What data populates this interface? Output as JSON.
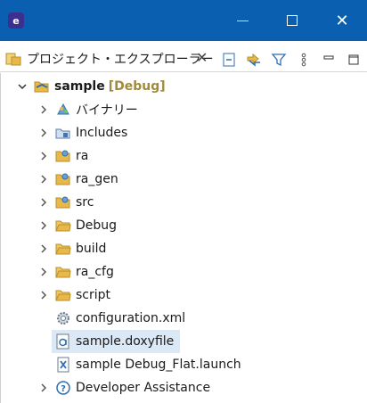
{
  "window": {
    "app_icon_glyph": "e",
    "minimize_glyph": "—",
    "close_glyph": "✕"
  },
  "view": {
    "tab_title": "プロジェクト・エクスプローラー",
    "tab_close_glyph": "✕",
    "toolbar_icons": [
      "collapse-all-icon",
      "link-with-editor-icon",
      "filter-icon",
      "view-menu-icon",
      "minimize-icon",
      "maximize-icon"
    ]
  },
  "tree": {
    "project": {
      "name": "sample",
      "decoration": "[Debug]"
    },
    "items": [
      {
        "label": "バイナリー",
        "icon": "binaries-icon"
      },
      {
        "label": "Includes",
        "icon": "includes-icon"
      },
      {
        "label": "ra",
        "icon": "source-folder-icon"
      },
      {
        "label": "ra_gen",
        "icon": "source-folder-icon"
      },
      {
        "label": "src",
        "icon": "source-folder-icon"
      },
      {
        "label": "Debug",
        "icon": "folder-icon"
      },
      {
        "label": "build",
        "icon": "folder-icon"
      },
      {
        "label": "ra_cfg",
        "icon": "folder-icon"
      },
      {
        "label": "script",
        "icon": "folder-icon"
      },
      {
        "label": "configuration.xml",
        "icon": "config-gear-icon"
      },
      {
        "label": "sample.doxyfile",
        "icon": "doxyfile-icon"
      },
      {
        "label": "sample Debug_Flat.launch",
        "icon": "launch-file-icon"
      },
      {
        "label": "Developer Assistance",
        "icon": "help-circle-icon"
      }
    ]
  },
  "colors": {
    "titlebar": "#0b5fb0",
    "selection": "#dbe9f7",
    "folder": "#e8b84a",
    "decoration": "#a08a3c"
  }
}
